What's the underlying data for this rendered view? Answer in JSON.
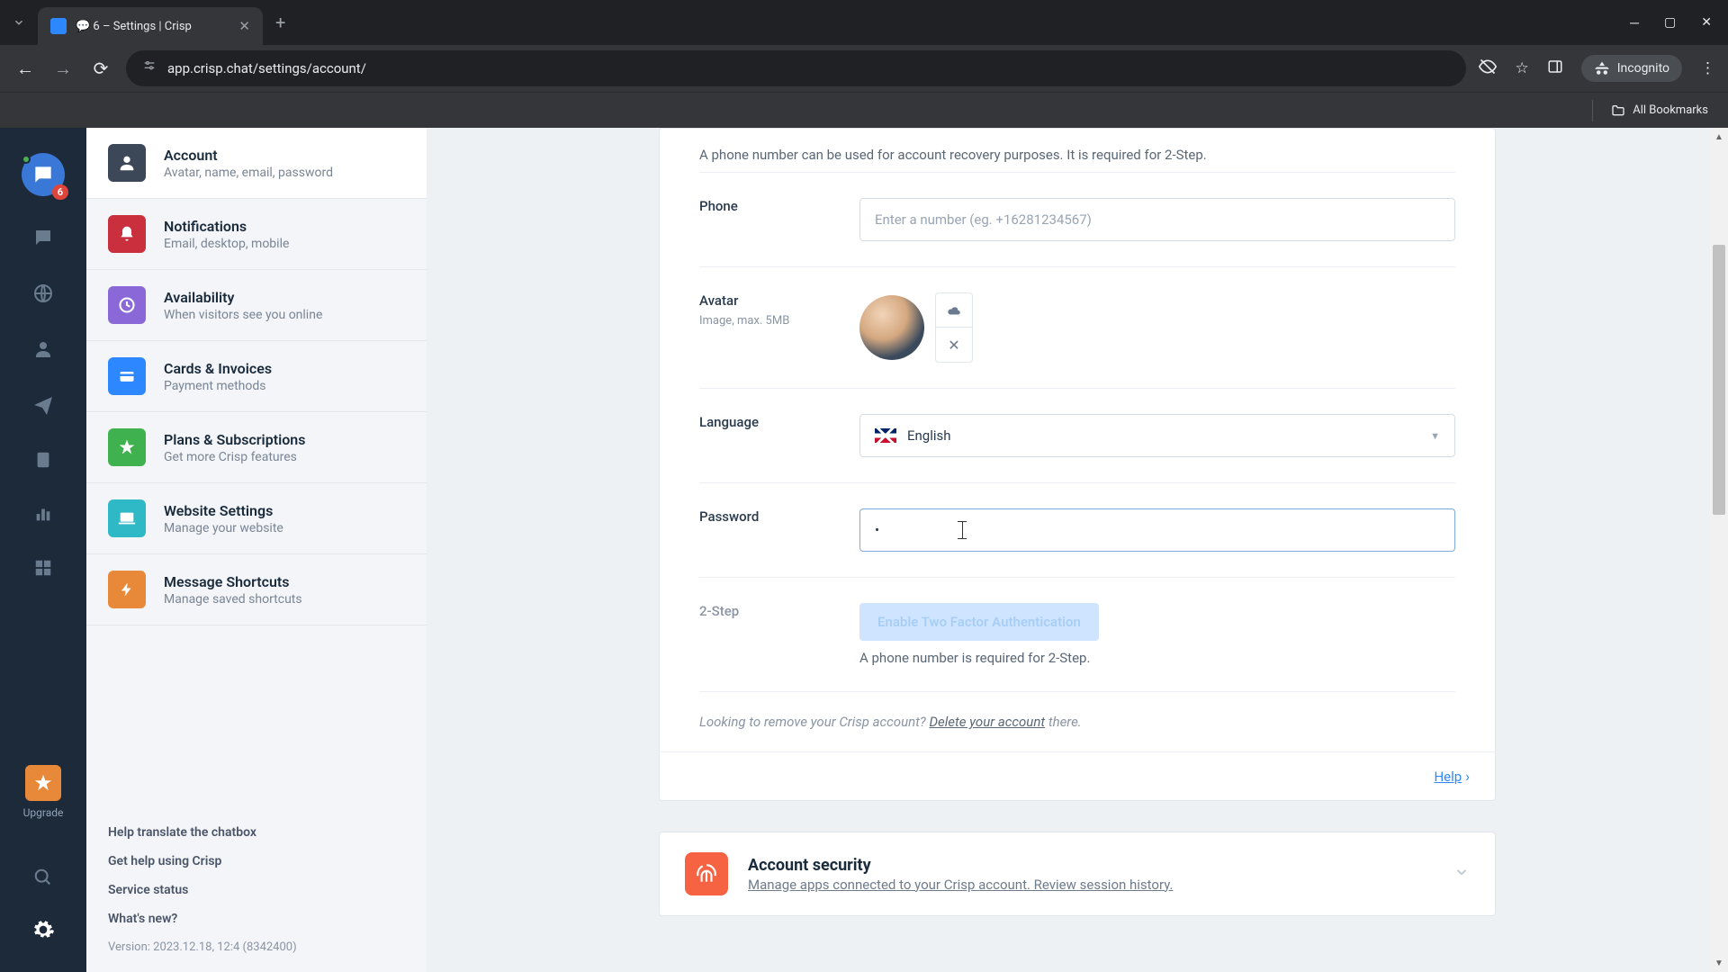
{
  "browser": {
    "tab_title": "💬 6 – Settings | Crisp",
    "url": "app.crisp.chat/settings/account/",
    "incognito": "Incognito",
    "bookmarks": "All Bookmarks"
  },
  "rail": {
    "badge": "6",
    "upgrade": "Upgrade"
  },
  "sidebar": {
    "items": [
      {
        "title": "Account",
        "sub": "Avatar, name, email, password",
        "color": "#3c4758"
      },
      {
        "title": "Notifications",
        "sub": "Email, desktop, mobile",
        "color": "#c92f3c"
      },
      {
        "title": "Availability",
        "sub": "When visitors see you online",
        "color": "#8a68d8"
      },
      {
        "title": "Cards & Invoices",
        "sub": "Payment methods",
        "color": "#2d88ff"
      },
      {
        "title": "Plans & Subscriptions",
        "sub": "Get more Crisp features",
        "color": "#3fb24f"
      },
      {
        "title": "Website Settings",
        "sub": "Manage your website",
        "color": "#2fb8c5"
      },
      {
        "title": "Message Shortcuts",
        "sub": "Manage saved shortcuts",
        "color": "#e8893a"
      }
    ],
    "footer": {
      "translate": "Help translate the chatbox",
      "help": "Get help using Crisp",
      "status": "Service status",
      "whatsnew": "What's new?",
      "version": "Version: 2023.12.18, 12:4 (8342400)"
    }
  },
  "form": {
    "phone_hint": "A phone number can be used for account recovery purposes. It is required for 2-Step.",
    "phone_label": "Phone",
    "phone_placeholder": "Enter a number (eg. +16281234567)",
    "avatar_label": "Avatar",
    "avatar_sub": "Image, max. 5MB",
    "language_label": "Language",
    "language_value": "English",
    "password_label": "Password",
    "password_value": "•",
    "two_step_label": "2-Step",
    "two_step_button": "Enable Two Factor Authentication",
    "two_step_hint": "A phone number is required for 2-Step.",
    "delete_prompt": "Looking to remove your Crisp account?  ",
    "delete_link": "Delete your account",
    "delete_suffix": " there.",
    "help": "Help"
  },
  "security": {
    "title": "Account security",
    "sub": "Manage apps connected to your Crisp account. Review session history."
  }
}
